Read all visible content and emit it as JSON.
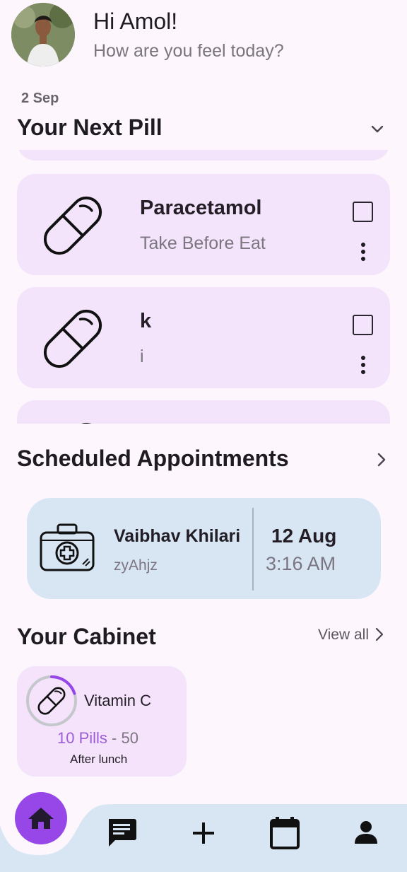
{
  "header": {
    "greeting": "Hi Amol!",
    "subtitle": "How are you feel today?"
  },
  "next_pill": {
    "date": "2 Sep",
    "title": "Your Next Pill",
    "items": [
      {
        "name": "Paracetamol",
        "instruction": "Take Before Eat",
        "checked": false
      },
      {
        "name": "k",
        "instruction": "i",
        "checked": false
      }
    ]
  },
  "appointments": {
    "title": "Scheduled Appointments",
    "items": [
      {
        "doctor": "Vaibhav Khilari",
        "code": "zyAhjz",
        "day": "12 Aug",
        "time": "3:16 AM"
      }
    ]
  },
  "cabinet": {
    "title": "Your Cabinet",
    "view_all": "View all",
    "items": [
      {
        "name": "Vitamin C",
        "pills_left": "10 Pills",
        "separator": " - ",
        "total": "50",
        "when": "After lunch",
        "progress": 0.2
      }
    ]
  },
  "colors": {
    "accent": "#9747e8",
    "pill_card": "#f3e4fb",
    "appointment_card": "#d8e6f4",
    "nav_bar": "#d8e6f4"
  },
  "icons": [
    "avatar",
    "chevron-down-icon",
    "pill-icon",
    "checkbox-icon",
    "more-vert-icon",
    "chevron-right-icon",
    "medical-kit-icon",
    "home-icon",
    "chat-icon",
    "add-icon",
    "calendar-icon",
    "profile-icon"
  ]
}
